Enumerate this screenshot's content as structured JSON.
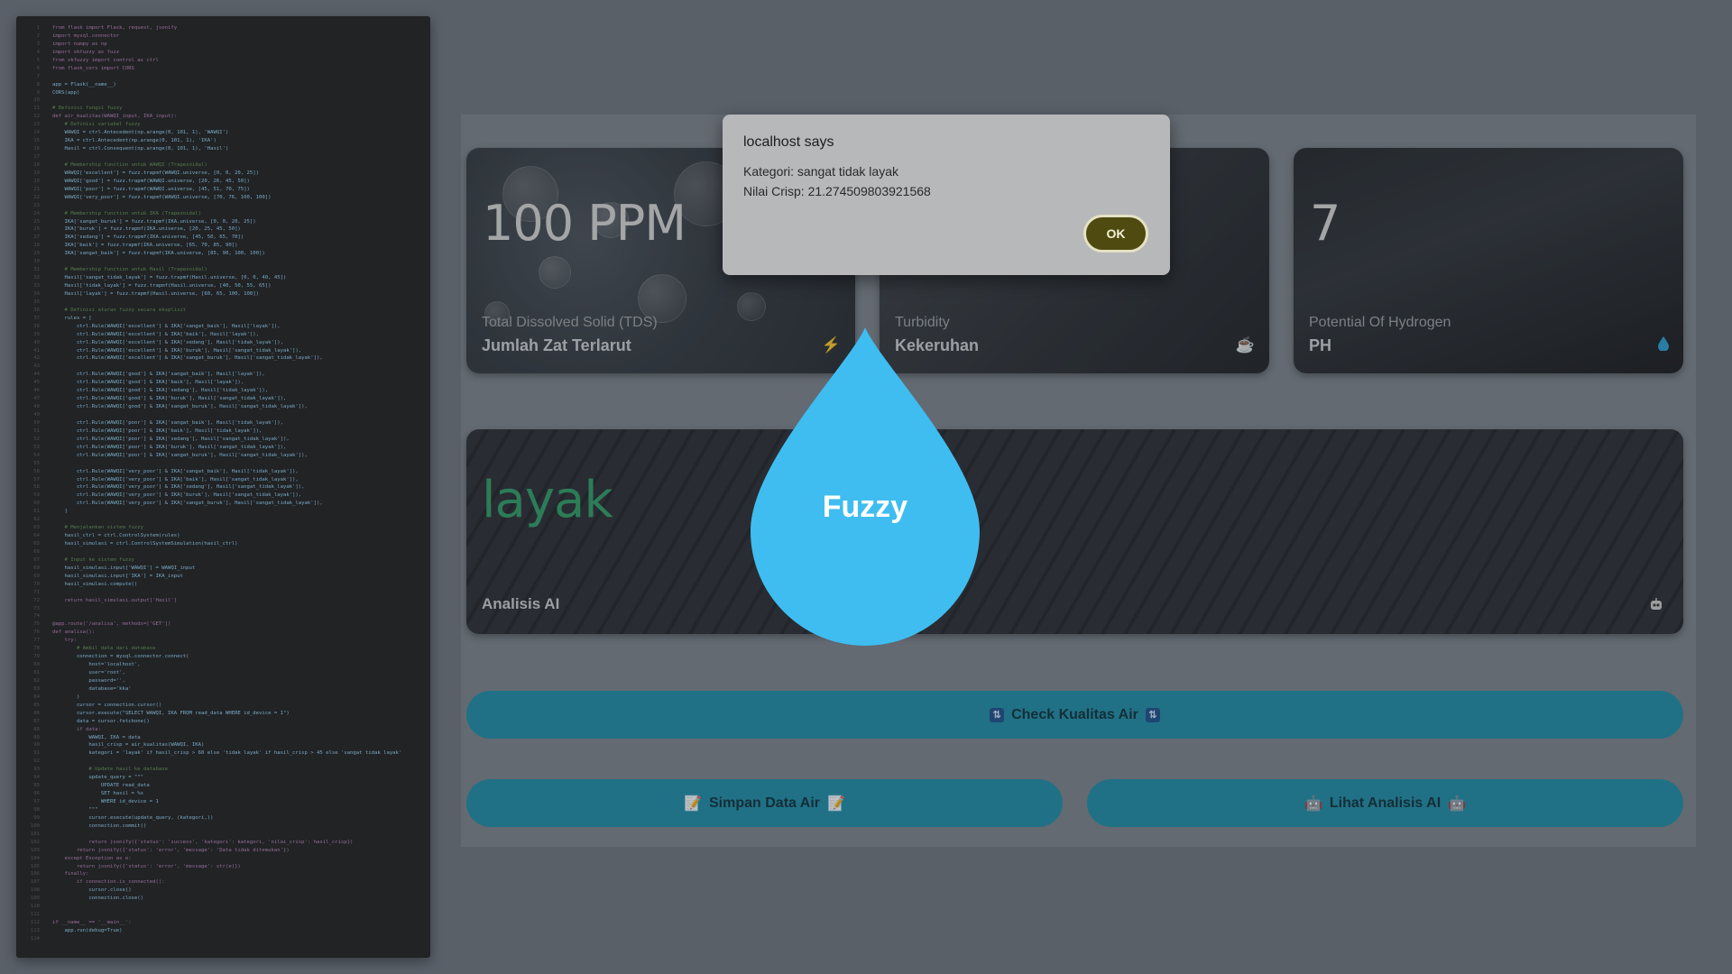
{
  "code_panel": {
    "lines": [
      "from flask import Flask, request, jsonify",
      "import mysql.connector",
      "import numpy as np",
      "import skfuzzy as fuzz",
      "from skfuzzy import control as ctrl",
      "from flask_cors import CORS",
      "",
      "app = Flask(__name__)",
      "CORS(app)",
      "",
      "# Definisi fungsi fuzzy",
      "def air_kualitas(WAWQI_input, IKA_input):",
      "    # Definisi variabel fuzzy",
      "    WAWQI = ctrl.Antecedent(np.arange(0, 101, 1), 'WAWQI')",
      "    IKA = ctrl.Antecedent(np.arange(0, 101, 1), 'IKA')",
      "    Hasil = ctrl.Consequent(np.arange(0, 101, 1), 'Hasil')",
      "",
      "    # Membership function untuk WAWQI (Trapezoidal)",
      "    WAWQI['excellent'] = fuzz.trapmf(WAWQI.universe, [0, 0, 20, 25])",
      "    WAWQI['good'] = fuzz.trapmf(WAWQI.universe, [20, 26, 45, 50])",
      "    WAWQI['poor'] = fuzz.trapmf(WAWQI.universe, [45, 51, 70, 75])",
      "    WAWQI['very_poor'] = fuzz.trapmf(WAWQI.universe, [70, 76, 100, 100])",
      "",
      "    # Membership function untuk IKA (Trapezoidal)",
      "    IKA['sangat_buruk'] = fuzz.trapmf(IKA.universe, [0, 0, 20, 25])",
      "    IKA['buruk'] = fuzz.trapmf(IKA.universe, [20, 25, 45, 50])",
      "    IKA['sedang'] = fuzz.trapmf(IKA.universe, [45, 50, 65, 70])",
      "    IKA['baik'] = fuzz.trapmf(IKA.universe, [65, 70, 85, 90])",
      "    IKA['sangat_baik'] = fuzz.trapmf(IKA.universe, [85, 90, 100, 100])",
      "",
      "    # Membership function untuk Hasil (Trapezoidal)",
      "    Hasil['sangat_tidak_layak'] = fuzz.trapmf(Hasil.universe, [0, 0, 40, 45])",
      "    Hasil['tidak_layak'] = fuzz.trapmf(Hasil.universe, [40, 50, 55, 65])",
      "    Hasil['layak'] = fuzz.trapmf(Hasil.universe, [60, 65, 100, 100])",
      "",
      "    # Definisi aturan fuzzy secara eksplisit",
      "    rules = [",
      "        ctrl.Rule(WAWQI['excellent'] & IKA['sangat_baik'], Hasil['layak']),",
      "        ctrl.Rule(WAWQI['excellent'] & IKA['baik'], Hasil['layak']),",
      "        ctrl.Rule(WAWQI['excellent'] & IKA['sedang'], Hasil['tidak_layak']),",
      "        ctrl.Rule(WAWQI['excellent'] & IKA['buruk'], Hasil['sangat_tidak_layak']),",
      "        ctrl.Rule(WAWQI['excellent'] & IKA['sangat_buruk'], Hasil['sangat_tidak_layak']),",
      "",
      "        ctrl.Rule(WAWQI['good'] & IKA['sangat_baik'], Hasil['layak']),",
      "        ctrl.Rule(WAWQI['good'] & IKA['baik'], Hasil['layak']),",
      "        ctrl.Rule(WAWQI['good'] & IKA['sedang'], Hasil['tidak_layak']),",
      "        ctrl.Rule(WAWQI['good'] & IKA['buruk'], Hasil['sangat_tidak_layak']),",
      "        ctrl.Rule(WAWQI['good'] & IKA['sangat_buruk'], Hasil['sangat_tidak_layak']),",
      "",
      "        ctrl.Rule(WAWQI['poor'] & IKA['sangat_baik'], Hasil['tidak_layak']),",
      "        ctrl.Rule(WAWQI['poor'] & IKA['baik'], Hasil['tidak_layak']),",
      "        ctrl.Rule(WAWQI['poor'] & IKA['sedang'], Hasil['sangat_tidak_layak']),",
      "        ctrl.Rule(WAWQI['poor'] & IKA['buruk'], Hasil['sangat_tidak_layak']),",
      "        ctrl.Rule(WAWQI['poor'] & IKA['sangat_buruk'], Hasil['sangat_tidak_layak']),",
      "",
      "        ctrl.Rule(WAWQI['very_poor'] & IKA['sangat_baik'], Hasil['tidak_layak']),",
      "        ctrl.Rule(WAWQI['very_poor'] & IKA['baik'], Hasil['sangat_tidak_layak']),",
      "        ctrl.Rule(WAWQI['very_poor'] & IKA['sedang'], Hasil['sangat_tidak_layak']),",
      "        ctrl.Rule(WAWQI['very_poor'] & IKA['buruk'], Hasil['sangat_tidak_layak']),",
      "        ctrl.Rule(WAWQI['very_poor'] & IKA['sangat_buruk'], Hasil['sangat_tidak_layak']),",
      "    ]",
      "",
      "    # Menjalankan sistem fuzzy",
      "    hasil_ctrl = ctrl.ControlSystem(rules)",
      "    hasil_simulasi = ctrl.ControlSystemSimulation(hasil_ctrl)",
      "",
      "    # Input ke sistem fuzzy",
      "    hasil_simulasi.input['WAWQI'] = WAWQI_input",
      "    hasil_simulasi.input['IKA'] = IKA_input",
      "    hasil_simulasi.compute()",
      "",
      "    return hasil_simulasi.output['Hasil']",
      "",
      "",
      "@app.route('/analisa', methods=['GET'])",
      "def analisa():",
      "    try:",
      "        # Ambil data dari database",
      "        connection = mysql.connector.connect(",
      "            host='localhost',",
      "            user='root',",
      "            password='',",
      "            database='kka'",
      "        )",
      "        cursor = connection.cursor()",
      "        cursor.execute(\"SELECT WAWQI, IKA FROM read_data WHERE id_device = 1\")",
      "        data = cursor.fetchone()",
      "        if data:",
      "            WAWQI, IKA = data",
      "            hasil_crisp = air_kualitas(WAWQI, IKA)",
      "            kategori = 'layak' if hasil_crisp > 60 else 'tidak layak' if hasil_crisp > 45 else 'sangat tidak layak'",
      "",
      "            # Update hasil ke database",
      "            update_query = \"\"\"",
      "                UPDATE read_data",
      "                SET hasil = %s",
      "                WHERE id_device = 1",
      "            \"\"\"",
      "            cursor.execute(update_query, (kategori,))",
      "            connection.commit()",
      "",
      "            return jsonify({'status': 'success', 'kategori': kategori, 'nilai_crisp': hasil_crisp})",
      "        return jsonify({'status': 'error', 'message': 'Data tidak ditemukan'})",
      "    except Exception as e:",
      "        return jsonify({'status': 'error', 'message': str(e)})",
      "    finally:",
      "        if connection.is_connected():",
      "            cursor.close()",
      "            connection.close()",
      "",
      "",
      "if __name__ == '__main__':",
      "    app.run(debug=True)",
      ""
    ]
  },
  "cards": {
    "tds": {
      "value": "100 PPM",
      "subtitle": "Total Dissolved Solid (TDS)",
      "title": "Jumlah Zat Terlarut",
      "icon": "lightning-icon"
    },
    "turbidity": {
      "subtitle": "Turbidity",
      "title": "Kekeruhan",
      "icon": "coffee-cup-icon"
    },
    "ph": {
      "value": "7",
      "subtitle": "Potential Of Hydrogen",
      "title": "PH",
      "icon": "water-drop-icon"
    },
    "ai": {
      "value": "layak",
      "title": "Analisis AI",
      "icon": "robot-icon"
    }
  },
  "fuzzy_drop": {
    "label": "Fuzzy",
    "color": "#3fbdf0"
  },
  "buttons": {
    "check": {
      "label": "Check Kualitas Air",
      "emoji": "⇅"
    },
    "save": {
      "label": "Simpan Data Air",
      "emoji": "📝"
    },
    "ai": {
      "label": "Lihat Analisis AI",
      "emoji": "🤖"
    }
  },
  "dialog": {
    "title": "localhost says",
    "line1": "Kategori: sangat tidak layak",
    "line2": "Nilai Crisp: 21.274509803921568",
    "ok_label": "OK"
  },
  "colors": {
    "button_bg": "#1d8fa8",
    "ai_value": "#2e9e67",
    "dialog_bg": "#b7b8ba",
    "ok_bg": "#4e4a10"
  }
}
